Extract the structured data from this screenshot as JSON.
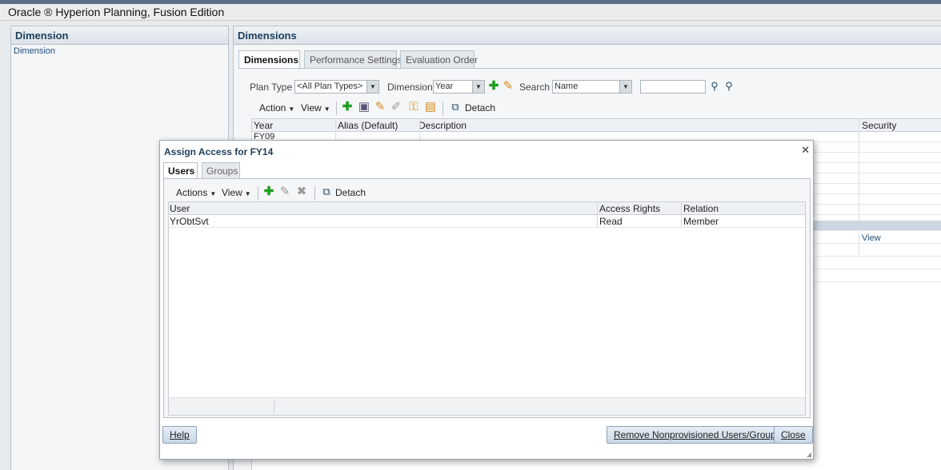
{
  "app": {
    "title": "Oracle ® Hyperion Planning, Fusion Edition"
  },
  "left_panel": {
    "title": "Dimension",
    "link": "Dimension"
  },
  "right_panel": {
    "title": "Dimensions",
    "tabs": [
      {
        "label": "Dimensions",
        "active": true
      },
      {
        "label": "Performance Settings",
        "active": false
      },
      {
        "label": "Evaluation Order",
        "active": false
      }
    ],
    "filters": {
      "plan_type_label": "Plan Type",
      "plan_type_value": "<All Plan Types>",
      "dimension_label": "Dimension",
      "dimension_value": "Year",
      "search_label": "Search",
      "search_field_value": "Name",
      "search_text": ""
    },
    "toolbar": {
      "action_label": "Action",
      "view_label": "View",
      "detach_label": "Detach"
    },
    "grid": {
      "columns": [
        "Year",
        "Alias (Default)",
        "Description",
        "Security"
      ],
      "first_row": "FY09",
      "security_link": "View"
    }
  },
  "dialog": {
    "title": "Assign Access for FY14",
    "tabs": [
      {
        "label": "Users",
        "active": true
      },
      {
        "label": "Groups",
        "active": false
      }
    ],
    "toolbar": {
      "actions_label": "Actions",
      "view_label": "View",
      "detach_label": "Detach"
    },
    "table": {
      "columns": [
        "User",
        "Access Rights",
        "Relation"
      ],
      "rows": [
        {
          "user": "YrObtSvt",
          "access": "Read",
          "relation": "Member"
        }
      ]
    },
    "buttons": {
      "help": "Help",
      "remove": "Remove Nonprovisioned Users/Groups",
      "close": "Close"
    }
  },
  "colors": {
    "accent": "#1d3e5c",
    "header_bar": "#5a6e86",
    "add_icon": "#1f9e1f"
  }
}
